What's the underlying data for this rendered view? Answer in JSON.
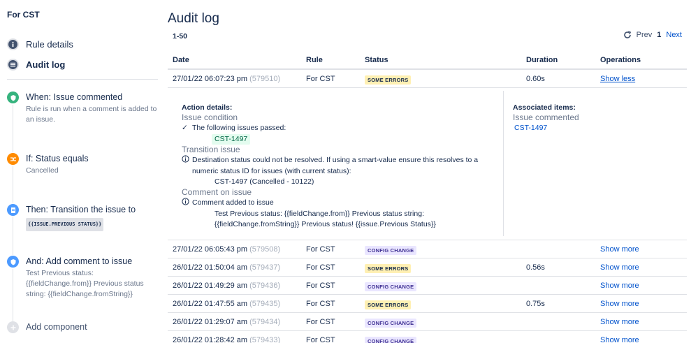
{
  "sidebar": {
    "project_title": "For CST",
    "nav": [
      {
        "label": "Rule details"
      },
      {
        "label": "Audit log"
      }
    ],
    "components": [
      {
        "title": "When: Issue commented",
        "subtitle": "Rule is run when a comment is added to an issue.",
        "color": "#36b37e"
      },
      {
        "title": "If: Status equals",
        "subtitle": "Cancelled",
        "color": "#ff8b00"
      },
      {
        "title": "Then: Transition the issue to",
        "tag": "{{ISSUE.PREVIOUS STATUS}}",
        "color": "#4c9aff"
      },
      {
        "title": "And: Add comment to issue",
        "subtitle": "Test Previous status: {{fieldChange.from}} Previous status string: {{fieldChange.fromString}}",
        "color": "#4c9aff"
      },
      {
        "title": "Add component",
        "color": "#dfe1e6"
      }
    ]
  },
  "main": {
    "title": "Audit log",
    "range": "1-50",
    "pager": {
      "prev": "Prev",
      "page": "1",
      "next": "Next"
    },
    "columns": [
      "Date",
      "Rule",
      "Status",
      "Duration",
      "Operations"
    ],
    "expanded_row": {
      "date": "27/01/22 06:07:23 pm",
      "id": "(579510)",
      "rule": "For CST",
      "status": "SOME ERRORS",
      "duration": "0.60s",
      "operation": "Show less"
    },
    "details": {
      "action_heading": "Action details:",
      "issue_condition": "Issue condition",
      "passed_text": "The following issues passed:",
      "passed_issue": "CST-1497",
      "transition_issue": "Transition issue",
      "transition_error": "Destination status could not be resolved. If using a smart-value ensure this resolves to a",
      "transition_error2": "numeric status ID for issues (with current status):",
      "transition_issue_status": "CST-1497 (Cancelled - 10122)",
      "comment_on_issue": "Comment on issue",
      "comment_added": "Comment added to issue",
      "comment_text1": "Test Previous status: {{fieldChange.from}} Previous status string:",
      "comment_text2": "{{fieldChange.fromString}} Previous status! {{issue.Previous Status}}",
      "assoc_heading": "Associated items:",
      "assoc_type": "Issue commented",
      "assoc_issue": "CST-1497"
    },
    "rows": [
      {
        "date": "27/01/22 06:05:43 pm",
        "id": "(579508)",
        "rule": "For CST",
        "status": "CONFIG CHANGE",
        "kind": "cfg",
        "duration": "",
        "operation": "Show more"
      },
      {
        "date": "26/01/22 01:50:04 am",
        "id": "(579437)",
        "rule": "For CST",
        "status": "SOME ERRORS",
        "kind": "err",
        "duration": "0.56s",
        "operation": "Show more"
      },
      {
        "date": "26/01/22 01:49:29 am",
        "id": "(579436)",
        "rule": "For CST",
        "status": "CONFIG CHANGE",
        "kind": "cfg",
        "duration": "",
        "operation": "Show more"
      },
      {
        "date": "26/01/22 01:47:55 am",
        "id": "(579435)",
        "rule": "For CST",
        "status": "SOME ERRORS",
        "kind": "err",
        "duration": "0.75s",
        "operation": "Show more"
      },
      {
        "date": "26/01/22 01:29:07 am",
        "id": "(579434)",
        "rule": "For CST",
        "status": "CONFIG CHANGE",
        "kind": "cfg",
        "duration": "",
        "operation": "Show more"
      },
      {
        "date": "26/01/22 01:28:42 am",
        "id": "(579433)",
        "rule": "For CST",
        "status": "CONFIG CHANGE",
        "kind": "cfg",
        "duration": "",
        "operation": "Show more"
      }
    ]
  }
}
